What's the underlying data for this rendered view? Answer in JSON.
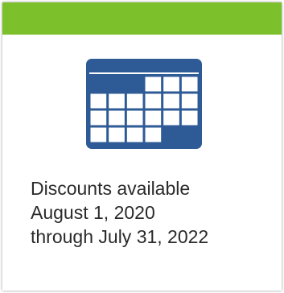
{
  "colors": {
    "accent_bar": "#7cc12b",
    "calendar_blue": "#2e5b96",
    "text": "#2a2a2a"
  },
  "icon": "calendar-icon",
  "promo": {
    "line1": "Discounts available",
    "line2": "August 1, 2020",
    "line3": "through July 31, 2022"
  }
}
